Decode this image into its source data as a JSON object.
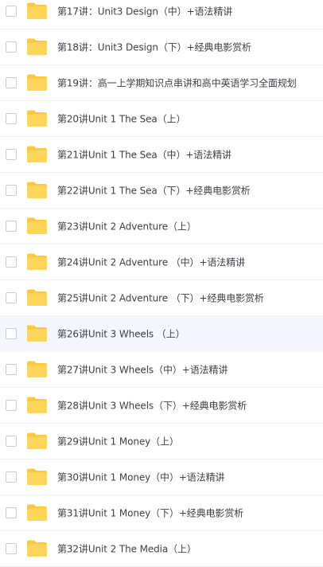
{
  "file_list": {
    "items": [
      {
        "name": "第17讲：Unit3 Design（中）+语法精讲",
        "icon": "folder-icon"
      },
      {
        "name": "第18讲：Unit3 Design（下）+经典电影赏析",
        "icon": "folder-icon"
      },
      {
        "name": "第19讲：高一上学期知识点串讲和高中英语学习全面规划",
        "icon": "folder-icon"
      },
      {
        "name": "第20讲Unit 1 The Sea（上）",
        "icon": "folder-icon"
      },
      {
        "name": "第21讲Unit 1 The Sea（中）+语法精讲",
        "icon": "folder-icon"
      },
      {
        "name": "第22讲Unit 1 The Sea（下）+经典电影赏析",
        "icon": "folder-icon"
      },
      {
        "name": "第23讲Unit 2 Adventure（上）",
        "icon": "folder-icon"
      },
      {
        "name": "第24讲Unit 2 Adventure （中）+语法精讲",
        "icon": "folder-icon"
      },
      {
        "name": "第25讲Unit 2 Adventure （下）+经典电影赏析",
        "icon": "folder-icon"
      },
      {
        "name": "第26讲Unit 3 Wheels （上）",
        "icon": "folder-icon"
      },
      {
        "name": "第27讲Unit 3 Wheels（中）+语法精讲",
        "icon": "folder-icon"
      },
      {
        "name": "第28讲Unit 3 Wheels（下）+经典电影赏析",
        "icon": "folder-icon"
      },
      {
        "name": "第29讲Unit 1 Money（上）",
        "icon": "folder-icon"
      },
      {
        "name": "第30讲Unit 1 Money（中）+语法精讲",
        "icon": "folder-icon"
      },
      {
        "name": "第31讲Unit 1 Money（下）+经典电影赏析",
        "icon": "folder-icon"
      },
      {
        "name": "第32讲Unit 2 The Media（上）",
        "icon": "folder-icon"
      }
    ]
  },
  "colors": {
    "folder_body": "#ffd659",
    "folder_back": "#ffc93d",
    "hover_row": "#f4f8fe",
    "text": "#3b3f47",
    "divider": "#f1f2f4"
  }
}
